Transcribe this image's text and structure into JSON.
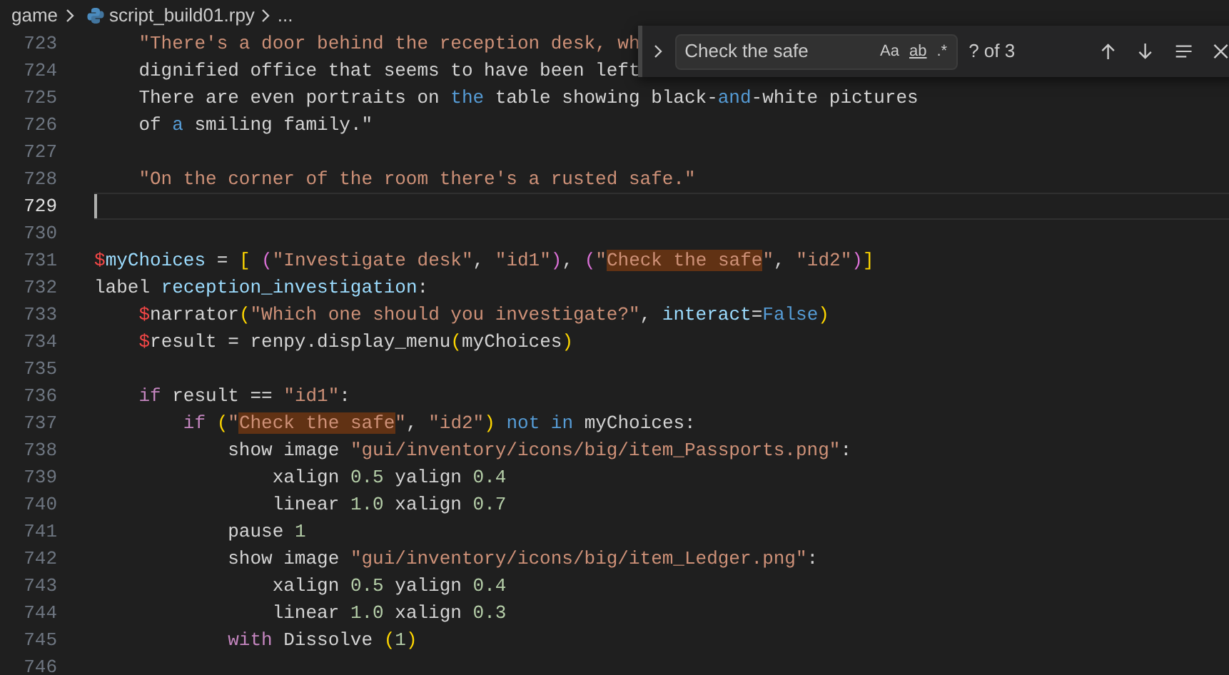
{
  "breadcrumb": {
    "folder": "game",
    "file": "script_build01.rpy",
    "more": "..."
  },
  "editor": {
    "lines": [
      {
        "number": "723",
        "current": false,
        "tokens": [
          {
            "text": "    \"There's a door behind the reception desk, wh",
            "kind": "string"
          }
        ]
      },
      {
        "number": "724",
        "current": false,
        "tokens": [
          {
            "text": "    dignified office that seems to have been left",
            "kind": "plain"
          }
        ]
      },
      {
        "number": "725",
        "current": false,
        "tokens": [
          {
            "text": "    There are even portraits on ",
            "kind": "plain"
          },
          {
            "text": "the",
            "kind": "keyword2"
          },
          {
            "text": " table showing black-",
            "kind": "plain"
          },
          {
            "text": "and",
            "kind": "keyword2"
          },
          {
            "text": "-white pictures",
            "kind": "plain"
          }
        ]
      },
      {
        "number": "726",
        "current": false,
        "tokens": [
          {
            "text": "    of ",
            "kind": "plain"
          },
          {
            "text": "a",
            "kind": "keyword2"
          },
          {
            "text": " smiling family.\"",
            "kind": "plain"
          }
        ]
      },
      {
        "number": "727",
        "current": false
      },
      {
        "number": "728",
        "current": false,
        "tokens": [
          {
            "text": "    \"On the corner of the room there's a rusted safe.\"",
            "kind": "string"
          }
        ]
      },
      {
        "number": "729",
        "current": true
      },
      {
        "number": "730",
        "current": false
      },
      {
        "number": "731",
        "current": false,
        "tokens": [
          {
            "text": "$",
            "kind": "dollar"
          },
          {
            "text": "myChoices",
            "kind": "variable"
          },
          {
            "text": " = ",
            "kind": "plain"
          },
          {
            "text": "[ ",
            "kind": "bracket1"
          },
          {
            "text": "(",
            "kind": "bracket2"
          },
          {
            "text": "\"Investigate desk\"",
            "kind": "string"
          },
          {
            "text": ", ",
            "kind": "plain"
          },
          {
            "text": "\"id1\"",
            "kind": "string"
          },
          {
            "text": ")",
            "kind": "bracket2"
          },
          {
            "text": ", ",
            "kind": "plain"
          },
          {
            "text": "(",
            "kind": "bracket2"
          },
          {
            "text": "\"",
            "kind": "string"
          },
          {
            "text": "Check the safe",
            "kind": "match"
          },
          {
            "text": "\"",
            "kind": "string"
          },
          {
            "text": ", ",
            "kind": "plain"
          },
          {
            "text": "\"id2\"",
            "kind": "string"
          },
          {
            "text": ")",
            "kind": "bracket2"
          },
          {
            "text": "]",
            "kind": "bracket1"
          }
        ]
      },
      {
        "number": "732",
        "current": false,
        "tokens": [
          {
            "text": "label ",
            "kind": "plain"
          },
          {
            "text": "reception_investigation",
            "kind": "variable"
          },
          {
            "text": ":",
            "kind": "plain"
          }
        ]
      },
      {
        "number": "733",
        "current": false,
        "tokens": [
          {
            "text": "    $",
            "kind": "dollar"
          },
          {
            "text": "narrator",
            "kind": "plain"
          },
          {
            "text": "(",
            "kind": "bracket1"
          },
          {
            "text": "\"Which one should you investigate?\"",
            "kind": "string"
          },
          {
            "text": ", ",
            "kind": "plain"
          },
          {
            "text": "interact",
            "kind": "variable"
          },
          {
            "text": "=",
            "kind": "plain"
          },
          {
            "text": "False",
            "kind": "keyword2"
          },
          {
            "text": ")",
            "kind": "bracket1"
          }
        ]
      },
      {
        "number": "734",
        "current": false,
        "tokens": [
          {
            "text": "    $",
            "kind": "dollar"
          },
          {
            "text": "result = renpy.display_menu",
            "kind": "plain"
          },
          {
            "text": "(",
            "kind": "bracket1"
          },
          {
            "text": "myChoices",
            "kind": "plain"
          },
          {
            "text": ")",
            "kind": "bracket1"
          }
        ]
      },
      {
        "number": "735",
        "current": false
      },
      {
        "number": "736",
        "current": false,
        "tokens": [
          {
            "text": "    if",
            "kind": "keyword"
          },
          {
            "text": " result == ",
            "kind": "plain"
          },
          {
            "text": "\"id1\"",
            "kind": "string"
          },
          {
            "text": ":",
            "kind": "plain"
          }
        ]
      },
      {
        "number": "737",
        "current": false,
        "tokens": [
          {
            "text": "        if ",
            "kind": "keyword"
          },
          {
            "text": "(",
            "kind": "bracket1"
          },
          {
            "text": "\"",
            "kind": "string"
          },
          {
            "text": "Check the safe",
            "kind": "match"
          },
          {
            "text": "\"",
            "kind": "string"
          },
          {
            "text": ", ",
            "kind": "plain"
          },
          {
            "text": "\"id2\"",
            "kind": "string"
          },
          {
            "text": ") ",
            "kind": "bracket1"
          },
          {
            "text": "not in",
            "kind": "keyword2"
          },
          {
            "text": " myChoices:",
            "kind": "plain"
          }
        ]
      },
      {
        "number": "738",
        "current": false,
        "tokens": [
          {
            "text": "            show image ",
            "kind": "plain"
          },
          {
            "text": "\"gui/inventory/icons/big/item_Passports.png\"",
            "kind": "string"
          },
          {
            "text": ":",
            "kind": "plain"
          }
        ]
      },
      {
        "number": "739",
        "current": false,
        "tokens": [
          {
            "text": "                xalign ",
            "kind": "plain"
          },
          {
            "text": "0.5",
            "kind": "number"
          },
          {
            "text": " yalign ",
            "kind": "plain"
          },
          {
            "text": "0.4",
            "kind": "number"
          }
        ]
      },
      {
        "number": "740",
        "current": false,
        "tokens": [
          {
            "text": "                linear ",
            "kind": "plain"
          },
          {
            "text": "1.0",
            "kind": "number"
          },
          {
            "text": " xalign ",
            "kind": "plain"
          },
          {
            "text": "0.7",
            "kind": "number"
          }
        ]
      },
      {
        "number": "741",
        "current": false,
        "tokens": [
          {
            "text": "            pause ",
            "kind": "plain"
          },
          {
            "text": "1",
            "kind": "number"
          }
        ]
      },
      {
        "number": "742",
        "current": false,
        "tokens": [
          {
            "text": "            show image ",
            "kind": "plain"
          },
          {
            "text": "\"gui/inventory/icons/big/item_Ledger.png\"",
            "kind": "string"
          },
          {
            "text": ":",
            "kind": "plain"
          }
        ]
      },
      {
        "number": "743",
        "current": false,
        "tokens": [
          {
            "text": "                xalign ",
            "kind": "plain"
          },
          {
            "text": "0.5",
            "kind": "number"
          },
          {
            "text": " yalign ",
            "kind": "plain"
          },
          {
            "text": "0.4",
            "kind": "number"
          }
        ]
      },
      {
        "number": "744",
        "current": false,
        "tokens": [
          {
            "text": "                linear ",
            "kind": "plain"
          },
          {
            "text": "1.0",
            "kind": "number"
          },
          {
            "text": " xalign ",
            "kind": "plain"
          },
          {
            "text": "0.3",
            "kind": "number"
          }
        ]
      },
      {
        "number": "745",
        "current": false,
        "tokens": [
          {
            "text": "            with",
            "kind": "keyword"
          },
          {
            "text": " Dissolve ",
            "kind": "plain"
          },
          {
            "text": "(",
            "kind": "bracket1"
          },
          {
            "text": "1",
            "kind": "number"
          },
          {
            "text": ")",
            "kind": "bracket1"
          }
        ]
      },
      {
        "number": "746",
        "current": false
      }
    ]
  },
  "find_widget": {
    "value": "Check the safe",
    "options": [
      "Aa",
      "ab",
      ".*"
    ],
    "result": "? of 3"
  }
}
